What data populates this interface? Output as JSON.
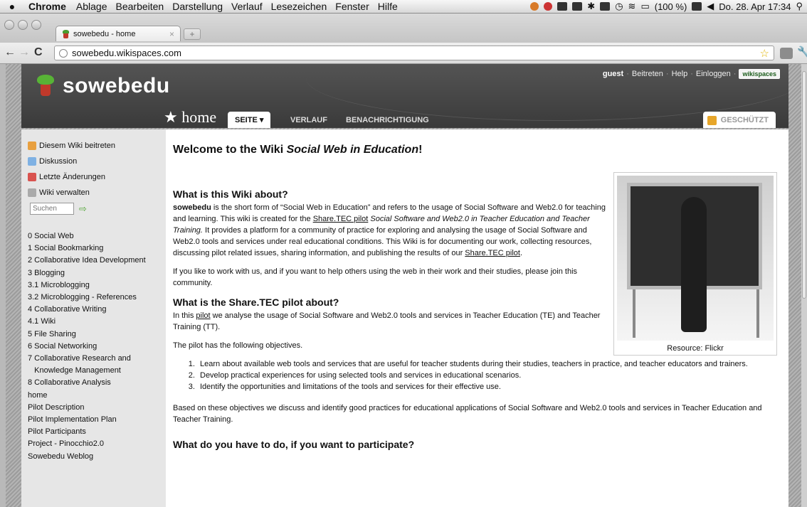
{
  "menubar": {
    "app": "Chrome",
    "items": [
      "Ablage",
      "Bearbeiten",
      "Darstellung",
      "Verlauf",
      "Lesezeichen",
      "Fenster",
      "Hilfe"
    ],
    "battery": "(100 %)",
    "datetime": "Do. 28. Apr  17:34"
  },
  "browser": {
    "tab_title": "sowebedu - home",
    "tab_close": "×",
    "new_tab": "+",
    "url": "sowebedu.wikispaces.com"
  },
  "wiki": {
    "site_name": "sowebedu",
    "user": {
      "name": "guest",
      "join": "Beitreten",
      "help": "Help",
      "login": "Einloggen",
      "badge": "wikispaces"
    },
    "home_label": "home",
    "tabs": [
      {
        "label": "SEITE ▾",
        "active": true
      },
      {
        "label": "VERLAUF",
        "active": false
      },
      {
        "label": "BENACHRICHTIGUNG",
        "active": false
      }
    ],
    "protected_label": "GESCHÜTZT"
  },
  "sidebar": {
    "actions": [
      {
        "label": "Diesem Wiki beitreten",
        "icon": "user-add-icon",
        "color": "#e8a040"
      },
      {
        "label": "Diskussion",
        "icon": "speech-bubble-icon",
        "color": "#7fb1e3"
      },
      {
        "label": "Letzte Änderungen",
        "icon": "calendar-icon",
        "color": "#d9534f"
      },
      {
        "label": "Wiki verwalten",
        "icon": "gear-icon",
        "color": "#aaaaaa"
      }
    ],
    "search_placeholder": "Suchen",
    "nav": [
      "0 Social Web",
      "1 Social Bookmarking",
      "2 Collaborative Idea Development",
      "3 Blogging",
      "3.1 Microblogging",
      "3.2 Microblogging - References",
      "4 Collaborative Writing",
      "4.1 Wiki",
      "5 File Sharing",
      "6 Social Networking",
      "7 Collaborative Research and",
      "   Knowledge Management",
      "8 Collaborative Analysis",
      "home",
      "Pilot Description",
      "Pilot Implementation Plan",
      "Pilot Participants",
      "Project - Pinocchio2.0",
      "Sowebedu Weblog"
    ]
  },
  "content": {
    "title_pre": "Welcome to the Wiki ",
    "title_em": "Social Web in Education",
    "title_post": "!",
    "figure_caption": "Resource: Flickr",
    "s1_heading": "What is this Wiki about?",
    "s1_p1": {
      "b": "sowebedu",
      "t1": " is the short form of “Social Web in Education” and refers to the usage of Social Software and Web2.0 for teaching and learning. This wiki is created for the ",
      "link1": "Share.TEC pilot",
      "t2": " ",
      "em": "Social Software and Web2.0 in Teacher Education and Teacher Training.",
      "t3": " It provides a platform for a community of practice for exploring and analysing the usage of Social Software and Web2.0 tools and services under real educational conditions. This Wiki is for documenting our work, collecting resources, discussing pilot related issues, sharing information, and publishing the results of our ",
      "link2": "Share.TEC pilot",
      "t4": "."
    },
    "s1_p2": "If you like to work with us, and if you want to help others using the web in their work and their studies, please join this community.",
    "s2_heading": "What is the Share.TEC pilot about?",
    "s2_p1": {
      "t1": "In this ",
      "link": "pilot",
      "t2": " we analyse the usage of Social Software and Web2.0 tools and services in Teacher Education (TE) and Teacher Training (TT)."
    },
    "s2_p2": "The pilot has the following objectives.",
    "objectives": [
      "Learn about available web tools and services that are useful for teacher students during their studies, teachers in practice, and teacher educators and trainers.",
      "Develop practical experiences for using selected tools and services in educational scenarios.",
      "Identify the opportunities and limitations of the tools and services for their effective use."
    ],
    "s2_p3": "Based on these objectives we discuss and identify good practices for educational applications of Social Software and Web2.0 tools and services in Teacher Education and Teacher Training.",
    "s3_heading": "What do you have to do, if you want to participate?"
  }
}
